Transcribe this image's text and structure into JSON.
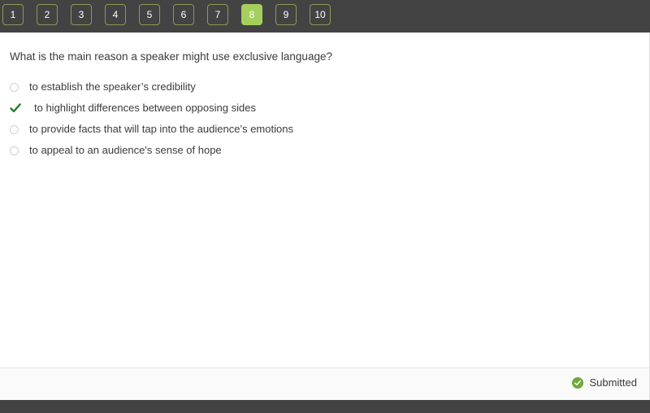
{
  "nav": {
    "items": [
      {
        "label": "1",
        "active": false
      },
      {
        "label": "2",
        "active": false
      },
      {
        "label": "3",
        "active": false
      },
      {
        "label": "4",
        "active": false
      },
      {
        "label": "5",
        "active": false
      },
      {
        "label": "6",
        "active": false
      },
      {
        "label": "7",
        "active": false
      },
      {
        "label": "8",
        "active": true
      },
      {
        "label": "9",
        "active": false
      },
      {
        "label": "10",
        "active": false
      }
    ],
    "active_question": "8",
    "background_color": "#434343",
    "active_color": "#a5cf5d",
    "border_color": "#8a9a54"
  },
  "question": {
    "text": "What is the main reason a speaker might use exclusive language?",
    "options": [
      {
        "label": "to establish the speaker’s credibility",
        "marker": "radio-unselected-icon",
        "selected": false
      },
      {
        "label": "to highlight differences between opposing sides",
        "marker": "check-mark-icon",
        "selected": true
      },
      {
        "label": "to provide facts that will tap into the audience’s emotions",
        "marker": "radio-unselected-icon",
        "selected": false
      },
      {
        "label": "to appeal to an audience's sense of hope",
        "marker": "radio-unselected-icon",
        "selected": false
      }
    ],
    "selected_color": "#1f7a1f"
  },
  "footer": {
    "status_label": "Submitted",
    "status_icon": "check-circle-icon",
    "status_color": "#6fa83a"
  }
}
